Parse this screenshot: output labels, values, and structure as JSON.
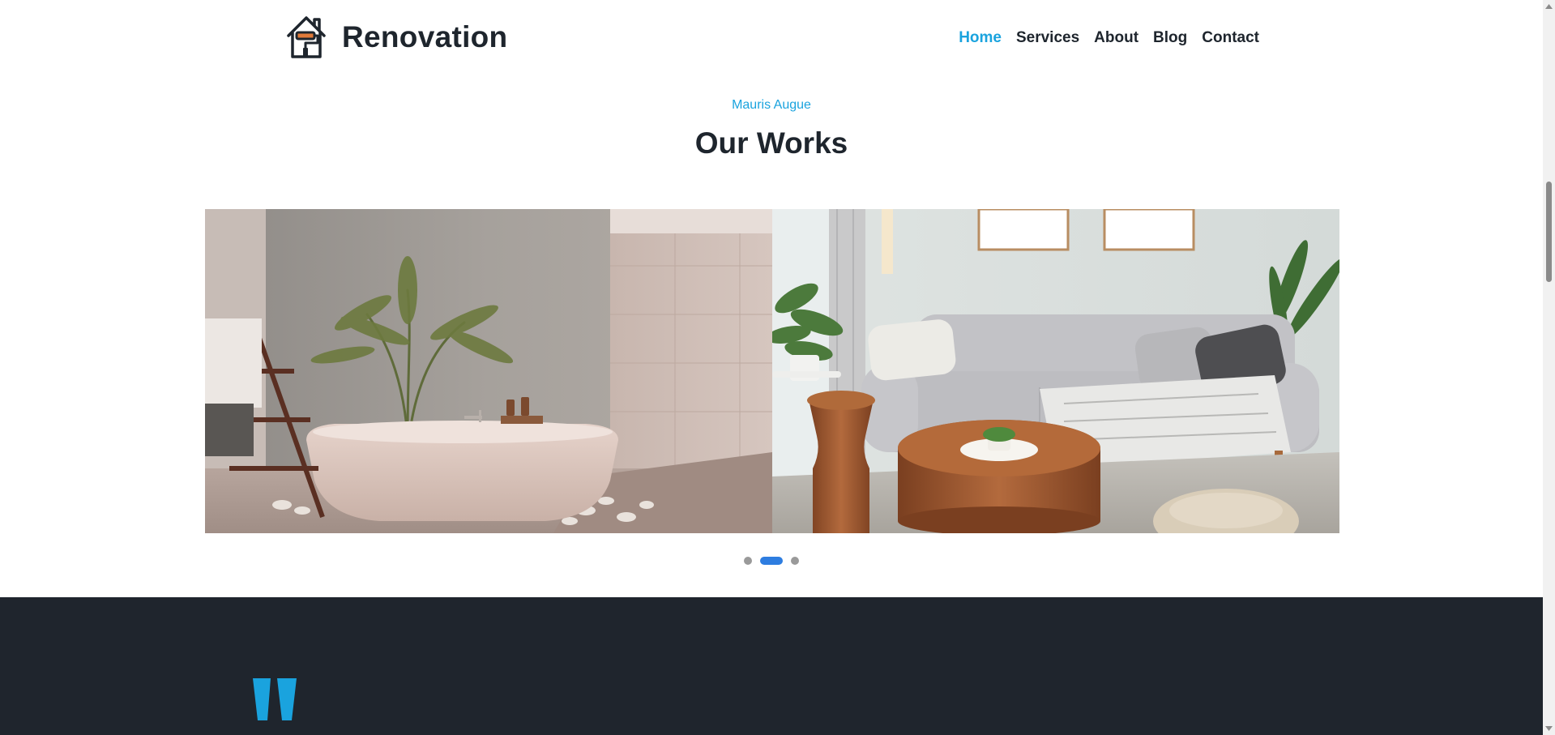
{
  "brand": {
    "name": "Renovation",
    "icon": "house-paint-roller-icon"
  },
  "nav": {
    "items": [
      {
        "label": "Home",
        "active": true
      },
      {
        "label": "Services",
        "active": false
      },
      {
        "label": "About",
        "active": false
      },
      {
        "label": "Blog",
        "active": false
      },
      {
        "label": "Contact",
        "active": false
      }
    ]
  },
  "works": {
    "eyebrow": "Mauris Augue",
    "title": "Our Works",
    "slides": [
      {
        "image": "bathroom-bathtub-photo"
      },
      {
        "image": "living-room-sofa-photo"
      }
    ],
    "pagination": {
      "count": 3,
      "active_index": 1
    }
  },
  "testimonial": {
    "icon": "quote-icon"
  },
  "colors": {
    "accent": "#1aa3de",
    "text": "#1e252d",
    "dark_band": "#1f252d",
    "dot_active": "#2e7de0",
    "dot_inactive": "#9a9a9a"
  }
}
